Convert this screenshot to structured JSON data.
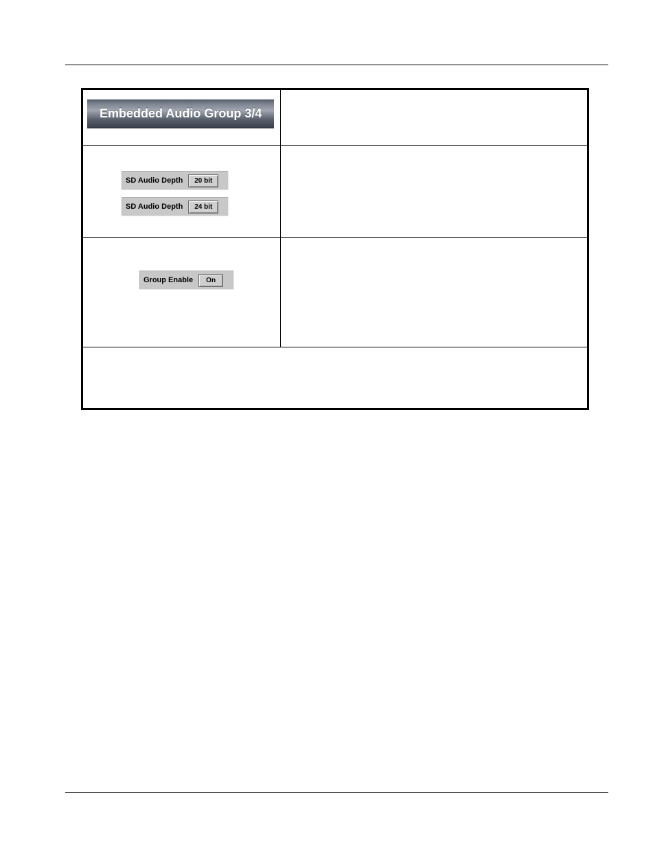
{
  "banner_title": "Embedded Audio Group 3/4",
  "controls": {
    "sd_audio_depth_label": "SD Audio Depth",
    "sd_audio_depth_20": "20 bit",
    "sd_audio_depth_24": "24 bit",
    "group_enable_label": "Group Enable",
    "group_enable_value": "On"
  }
}
